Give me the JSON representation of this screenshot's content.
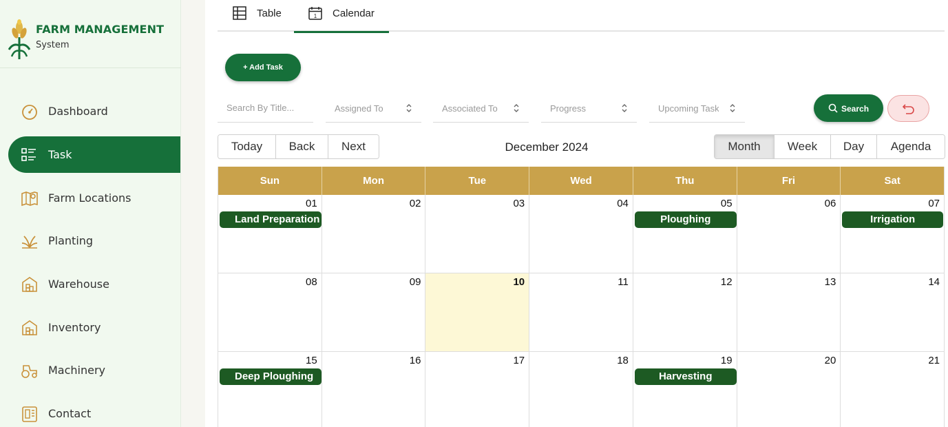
{
  "brand": {
    "title": "FARM MANAGEMENT",
    "subtitle": "System",
    "accent": "#16703a"
  },
  "sidebar": {
    "items": [
      {
        "label": "Dashboard",
        "icon": "gauge-icon",
        "active": false
      },
      {
        "label": "Task",
        "icon": "task-list-icon",
        "active": true
      },
      {
        "label": "Farm Locations",
        "icon": "map-pin-icon",
        "active": false
      },
      {
        "label": "Planting",
        "icon": "sprout-icon",
        "active": false
      },
      {
        "label": "Warehouse",
        "icon": "warehouse-icon",
        "active": false
      },
      {
        "label": "Inventory",
        "icon": "inventory-icon",
        "active": false
      },
      {
        "label": "Machinery",
        "icon": "tractor-icon",
        "active": false
      },
      {
        "label": "Contact",
        "icon": "contact-icon",
        "active": false
      }
    ]
  },
  "tabs": [
    {
      "label": "Table",
      "icon": "table-icon",
      "active": false
    },
    {
      "label": "Calendar",
      "icon": "calendar-icon",
      "active": true
    }
  ],
  "actions": {
    "add_task": "+ Add Task",
    "search": "Search"
  },
  "filters": {
    "title_placeholder": "Search By Title...",
    "assigned_to": "Assigned To",
    "associated_to": "Associated To",
    "progress": "Progress",
    "upcoming": "Upcoming Task"
  },
  "toolbar": {
    "nav": [
      "Today",
      "Back",
      "Next"
    ],
    "label": "December 2024",
    "views": [
      "Month",
      "Week",
      "Day",
      "Agenda"
    ],
    "active_view": "Month"
  },
  "calendar": {
    "header_color": "#c9a24b",
    "event_color": "#1d5a23",
    "weekdays": [
      "Sun",
      "Mon",
      "Tue",
      "Wed",
      "Thu",
      "Fri",
      "Sat"
    ],
    "today": "10",
    "weeks": [
      [
        {
          "date": "01",
          "event": "Land Preparation"
        },
        {
          "date": "02",
          "event": null
        },
        {
          "date": "03",
          "event": null
        },
        {
          "date": "04",
          "event": null
        },
        {
          "date": "05",
          "event": "Ploughing"
        },
        {
          "date": "06",
          "event": null
        },
        {
          "date": "07",
          "event": "Irrigation"
        }
      ],
      [
        {
          "date": "08",
          "event": null
        },
        {
          "date": "09",
          "event": null
        },
        {
          "date": "10",
          "event": null
        },
        {
          "date": "11",
          "event": null
        },
        {
          "date": "12",
          "event": null
        },
        {
          "date": "13",
          "event": null
        },
        {
          "date": "14",
          "event": null
        }
      ],
      [
        {
          "date": "15",
          "event": "Deep Ploughing"
        },
        {
          "date": "16",
          "event": null
        },
        {
          "date": "17",
          "event": null
        },
        {
          "date": "18",
          "event": null
        },
        {
          "date": "19",
          "event": "Harvesting"
        },
        {
          "date": "20",
          "event": null
        },
        {
          "date": "21",
          "event": null
        }
      ]
    ]
  }
}
